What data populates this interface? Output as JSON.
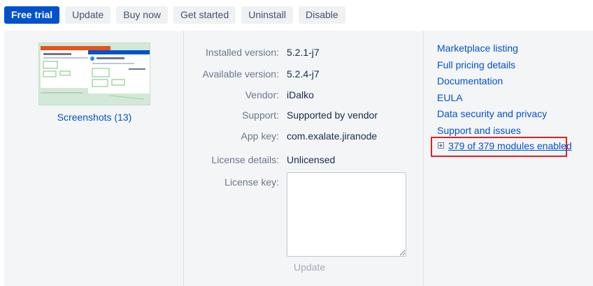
{
  "toolbar": {
    "buttons": [
      "Free trial",
      "Update",
      "Buy now",
      "Get started",
      "Uninstall",
      "Disable"
    ]
  },
  "screenshots": {
    "link_label": "Screenshots (13)"
  },
  "details": {
    "installed_version": {
      "label": "Installed version:",
      "value": "5.2.1-j7"
    },
    "available_version": {
      "label": "Available version:",
      "value": "5.2.4-j7"
    },
    "vendor": {
      "label": "Vendor:",
      "value": "iDalko"
    },
    "support": {
      "label": "Support:",
      "value": "Supported by vendor"
    },
    "app_key": {
      "label": "App key:",
      "value": "com.exalate.jiranode"
    },
    "license_details": {
      "label": "License details:",
      "value": "Unlicensed"
    },
    "license_key": {
      "label": "License key:",
      "value": ""
    },
    "update_label": "Update"
  },
  "links": [
    "Marketplace listing",
    "Full pricing details",
    "Documentation",
    "EULA",
    "Data security and privacy",
    "Support and issues"
  ],
  "modules": {
    "label": "379 of 379 modules enabled"
  },
  "colors": {
    "primary": "#0052cc",
    "highlight_border": "#e02020",
    "panel_bg": "#f4f5f7"
  }
}
